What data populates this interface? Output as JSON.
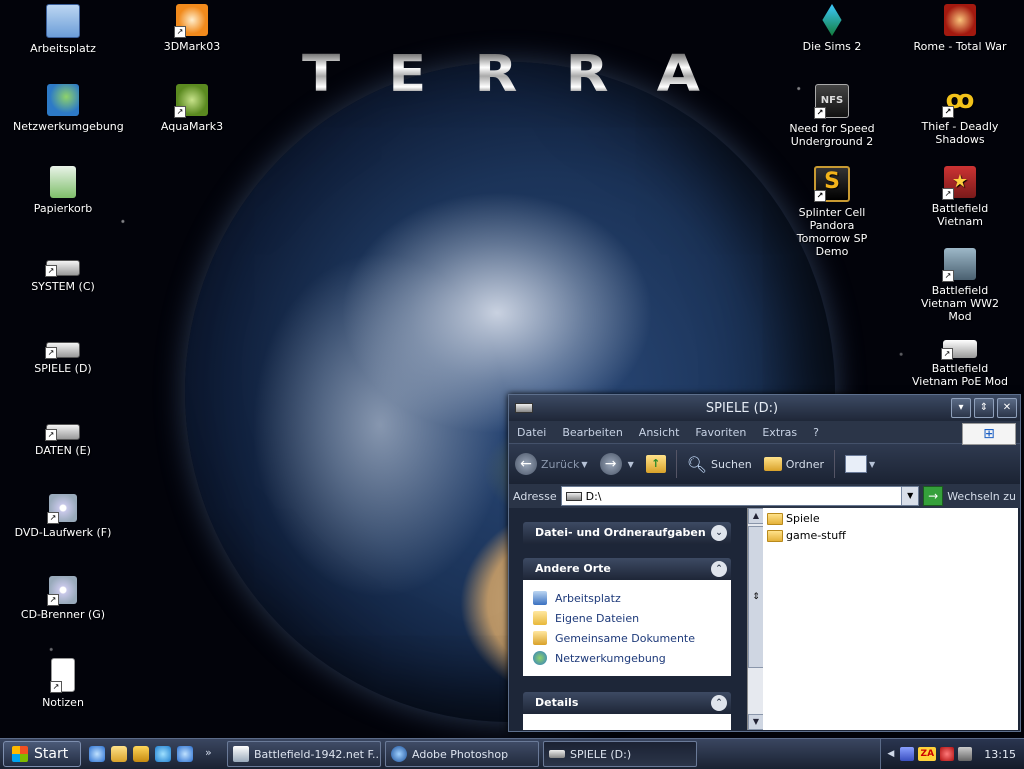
{
  "desktop": {
    "wallpaper_text": "TERRA",
    "left_icons": [
      {
        "label": "Arbeitsplatz",
        "icon": "my-computer-icon",
        "shortcut": false
      },
      {
        "label": "Netzwerkumgebung",
        "icon": "network-places-icon",
        "shortcut": false
      },
      {
        "label": "Papierkorb",
        "icon": "recycle-bin-icon",
        "shortcut": false
      },
      {
        "label": "SYSTEM (C)",
        "icon": "drive-icon",
        "shortcut": true
      },
      {
        "label": "SPIELE (D)",
        "icon": "drive-icon",
        "shortcut": true
      },
      {
        "label": "DATEN (E)",
        "icon": "drive-icon",
        "shortcut": true
      },
      {
        "label": "DVD-Laufwerk (F)",
        "icon": "cd-drive-icon",
        "shortcut": true
      },
      {
        "label": "CD-Brenner (G)",
        "icon": "cd-drive-icon",
        "shortcut": true
      },
      {
        "label": "Notizen",
        "icon": "notepad-icon",
        "shortcut": true
      }
    ],
    "col2_icons": [
      {
        "label": "3DMark03",
        "icon": "3dmark-icon",
        "shortcut": true
      },
      {
        "label": "AquaMark3",
        "icon": "aquamark-icon",
        "shortcut": true
      }
    ],
    "right_icons": [
      {
        "label": "Die Sims 2",
        "icon": "sims-icon",
        "shortcut": true
      },
      {
        "label": "Rome - Total War",
        "icon": "rome-icon",
        "shortcut": true
      },
      {
        "label": "Need for Speed Underground 2",
        "icon": "nfs-icon",
        "shortcut": true
      },
      {
        "label": "Thief - Deadly Shadows",
        "icon": "thief-icon",
        "shortcut": true
      },
      {
        "label": "Splinter Cell Pandora Tomorrow SP Demo",
        "icon": "splinter-cell-icon",
        "shortcut": true
      },
      {
        "label": "Battlefield Vietnam",
        "icon": "battlefield-vietnam-icon",
        "shortcut": true
      },
      {
        "label": "Battlefield Vietnam WW2 Mod",
        "icon": "battlefield-ww2-mod-icon",
        "shortcut": true
      },
      {
        "label": "Battlefield Vietnam PoE Mod",
        "icon": "battlefield-poe-mod-icon",
        "shortcut": true
      }
    ]
  },
  "window": {
    "title": "SPIELE (D:)",
    "menu": [
      "Datei",
      "Bearbeiten",
      "Ansicht",
      "Favoriten",
      "Extras",
      "?"
    ],
    "toolbar": {
      "back_label": "Zurück",
      "search_label": "Suchen",
      "folders_label": "Ordner"
    },
    "address": {
      "label": "Adresse",
      "value": "D:\\",
      "go_label": "Wechseln zu"
    },
    "taskpane": {
      "file_tasks_title": "Datei- und Ordneraufgaben",
      "other_places_title": "Andere Orte",
      "other_places": [
        {
          "label": "Arbeitsplatz",
          "icon": "my-computer-icon"
        },
        {
          "label": "Eigene Dateien",
          "icon": "my-documents-icon"
        },
        {
          "label": "Gemeinsame Dokumente",
          "icon": "shared-documents-icon"
        },
        {
          "label": "Netzwerkumgebung",
          "icon": "network-places-icon"
        }
      ],
      "details_title": "Details"
    },
    "files": [
      {
        "name": "Spiele",
        "type": "folder"
      },
      {
        "name": "game-stuff",
        "type": "folder"
      }
    ]
  },
  "taskbar": {
    "start_label": "Start",
    "more_label": "»",
    "tasks": [
      {
        "label": "Battlefield-1942.net F...",
        "icon": "browser-icon",
        "active": false
      },
      {
        "label": "Adobe Photoshop",
        "icon": "photoshop-icon",
        "active": false
      },
      {
        "label": "SPIELE (D:)",
        "icon": "drive-icon",
        "active": true
      }
    ],
    "tray_zonealarm": "ZA",
    "clock": "13:15"
  }
}
